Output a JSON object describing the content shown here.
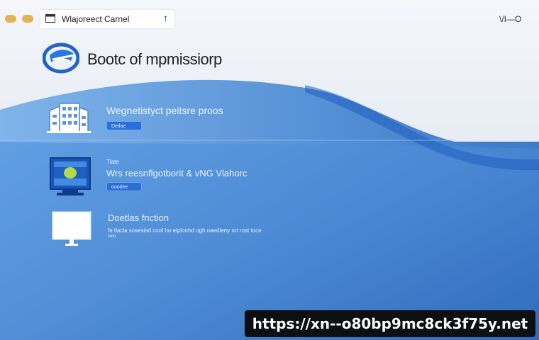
{
  "window": {
    "tab_title": "Wlajoreect Carnel",
    "tab_close": "↑",
    "controls": "\\/Ι—Ο",
    "app_title": "Bootc of mpmissiorp"
  },
  "sections": [
    {
      "title": "Wegnetistyct peitsre proos",
      "pill": "Detlae"
    },
    {
      "kicker": "Tlate",
      "title": "Wrs reesnflgotborit & vNG Vlahorc",
      "pill": "ooodee"
    },
    {
      "title": "Doetlas fnction",
      "description": "fe tlacla sosesisd coof ho eiplonhd ogh oaedleny rot rost toce",
      "meta": "celo"
    }
  ],
  "badge": {
    "url": "https://xn--o80bp9mc8ck3f75y.net"
  },
  "colors": {
    "background_blue": "#3f7fcc",
    "pill_blue": "#2a6fd6",
    "dot_yellow": "#e2b552",
    "badge_black": "#0e0f12"
  },
  "icons": [
    "window-dot",
    "tab-icon",
    "logo-icon",
    "building-icon",
    "monitor-icon",
    "display-icon"
  ]
}
